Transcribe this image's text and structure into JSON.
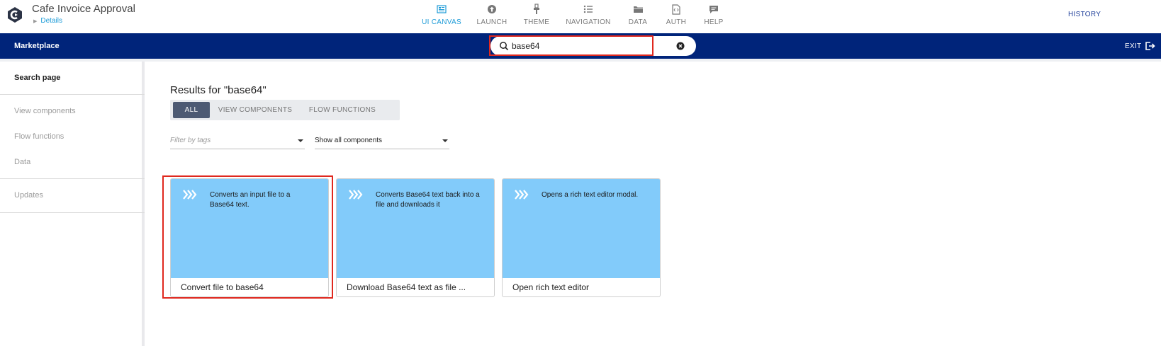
{
  "app": {
    "title": "Cafe Invoice Approval",
    "subtitle": "Details"
  },
  "nav_tabs": [
    {
      "label": "UI CANVAS",
      "icon": "ui-canvas-icon",
      "active": true
    },
    {
      "label": "LAUNCH",
      "icon": "launch-icon",
      "active": false
    },
    {
      "label": "THEME",
      "icon": "theme-icon",
      "active": false
    },
    {
      "label": "NAVIGATION",
      "icon": "navigation-icon",
      "active": false
    },
    {
      "label": "DATA",
      "icon": "folder-icon",
      "active": false
    },
    {
      "label": "AUTH",
      "icon": "auth-file-icon",
      "active": false
    },
    {
      "label": "HELP",
      "icon": "chat-icon",
      "active": false
    }
  ],
  "history_label": "HISTORY",
  "bluebar": {
    "title": "Marketplace",
    "search_value": "base64",
    "exit_label": "EXIT"
  },
  "sidebar": {
    "items": [
      {
        "label": "Search page",
        "active": true
      },
      {
        "label": "View components",
        "active": false
      },
      {
        "label": "Flow functions",
        "active": false
      },
      {
        "label": "Data",
        "active": false
      },
      {
        "label": "Updates",
        "active": false
      }
    ]
  },
  "main": {
    "results_title": "Results for \"base64\"",
    "filter_tabs": [
      {
        "label": "ALL",
        "active": true
      },
      {
        "label": "VIEW COMPONENTS",
        "active": false
      },
      {
        "label": "FLOW FUNCTIONS",
        "active": false
      }
    ],
    "tag_filter_placeholder": "Filter by tags",
    "component_filter_value": "Show all components",
    "cards": [
      {
        "description": "Converts an input file to a Base64 text.",
        "name": "Convert file to base64"
      },
      {
        "description": "Converts Base64 text back into a file and downloads it",
        "name": "Download Base64 text as file ..."
      },
      {
        "description": "Opens a rich text editor modal.",
        "name": "Open rich text editor"
      }
    ]
  },
  "colors": {
    "bluebar": "#00247a",
    "accent": "#1d9bd7",
    "card_top": "#82cbfa",
    "highlight": "#e0281e"
  }
}
